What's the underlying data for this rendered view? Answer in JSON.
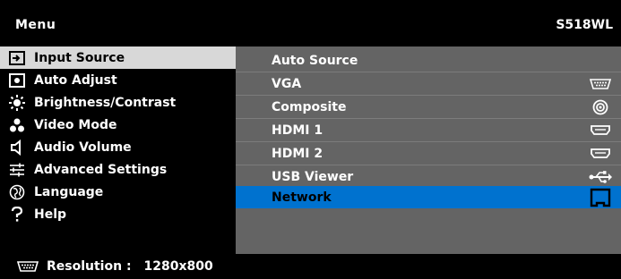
{
  "menu": {
    "title": "Menu",
    "model": "S518WL",
    "items": [
      {
        "label": "Input Source",
        "icon": "input-source-icon",
        "selected": true
      },
      {
        "label": "Auto Adjust",
        "icon": "auto-adjust-icon"
      },
      {
        "label": "Brightness/Contrast",
        "icon": "brightness-icon"
      },
      {
        "label": "Video Mode",
        "icon": "video-mode-icon"
      },
      {
        "label": "Audio Volume",
        "icon": "speaker-icon"
      },
      {
        "label": "Advanced Settings",
        "icon": "sliders-icon"
      },
      {
        "label": "Language",
        "icon": "globe-icon"
      },
      {
        "label": "Help",
        "icon": "question-icon"
      }
    ]
  },
  "submenu": {
    "items": [
      {
        "label": "Auto Source",
        "icon": null
      },
      {
        "label": "VGA",
        "icon": "vga-port-icon"
      },
      {
        "label": "Composite",
        "icon": "composite-port-icon"
      },
      {
        "label": "HDMI 1",
        "icon": "hdmi-port-icon"
      },
      {
        "label": "HDMI 2",
        "icon": "hdmi-port-icon"
      },
      {
        "label": "USB Viewer",
        "icon": "usb-icon"
      },
      {
        "label": "Network",
        "icon": "network-port-icon",
        "highlighted": true
      }
    ]
  },
  "status": {
    "label": "Resolution :",
    "value": "1280x800",
    "icon": "vga-port-icon"
  },
  "colors": {
    "background": "#000000",
    "selected_item": "#d8d8d8",
    "submenu_panel": "#646464",
    "highlight": "#0072cf"
  }
}
